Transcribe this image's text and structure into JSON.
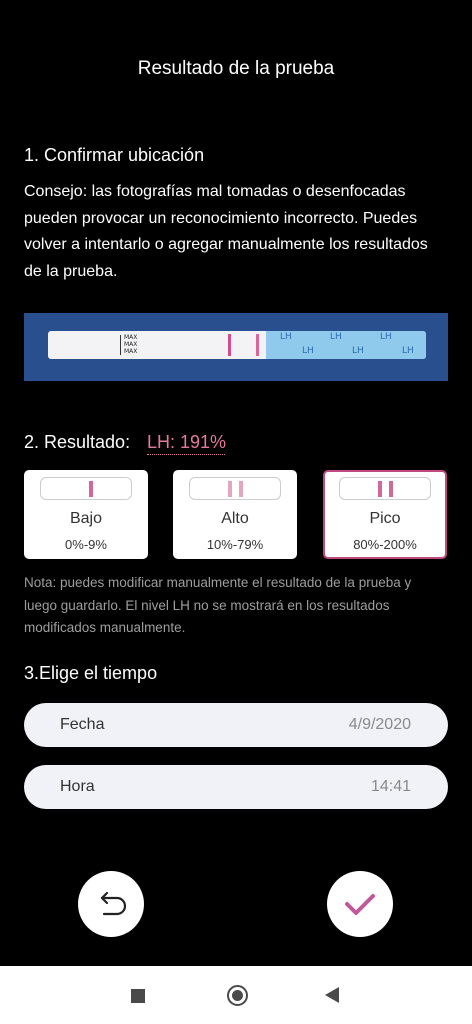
{
  "title": "Resultado de la prueba",
  "section1": {
    "heading": "1. Confirmar ubicación",
    "tip": "Consejo: las fotografías mal tomadas o desenfocadas pueden provocar un reconocimiento incorrecto. Puedes volver a intentarlo o agregar manualmente los resultados de la prueba."
  },
  "strip": {
    "marks": [
      "MAX",
      "MAX",
      "MAX"
    ],
    "brand_text": [
      "LH",
      "LH",
      "LH",
      "LH",
      "LH",
      "LH"
    ]
  },
  "section2": {
    "heading": "2. Resultado:",
    "lh_value": "LH: 191%",
    "options": [
      {
        "label": "Bajo",
        "range": "0%-9%",
        "selected": false
      },
      {
        "label": "Alto",
        "range": "10%-79%",
        "selected": false
      },
      {
        "label": "Pico",
        "range": "80%-200%",
        "selected": true
      }
    ],
    "note": "Nota: puedes modificar manualmente el resultado de la prueba y luego guardarlo. El nivel LH no se mostrará en los resultados modificados manualmente."
  },
  "section3": {
    "heading": "3.Elige el tiempo",
    "date_label": "Fecha",
    "date_value": "4/9/2020",
    "time_label": "Hora",
    "time_value": "14:41"
  },
  "icons": {
    "back": "undo-icon",
    "confirm": "checkmark-icon"
  },
  "colors": {
    "accent": "#e6799f",
    "line": "#d2679a",
    "selected_border": "#c0497f",
    "check": "#c0589a"
  }
}
